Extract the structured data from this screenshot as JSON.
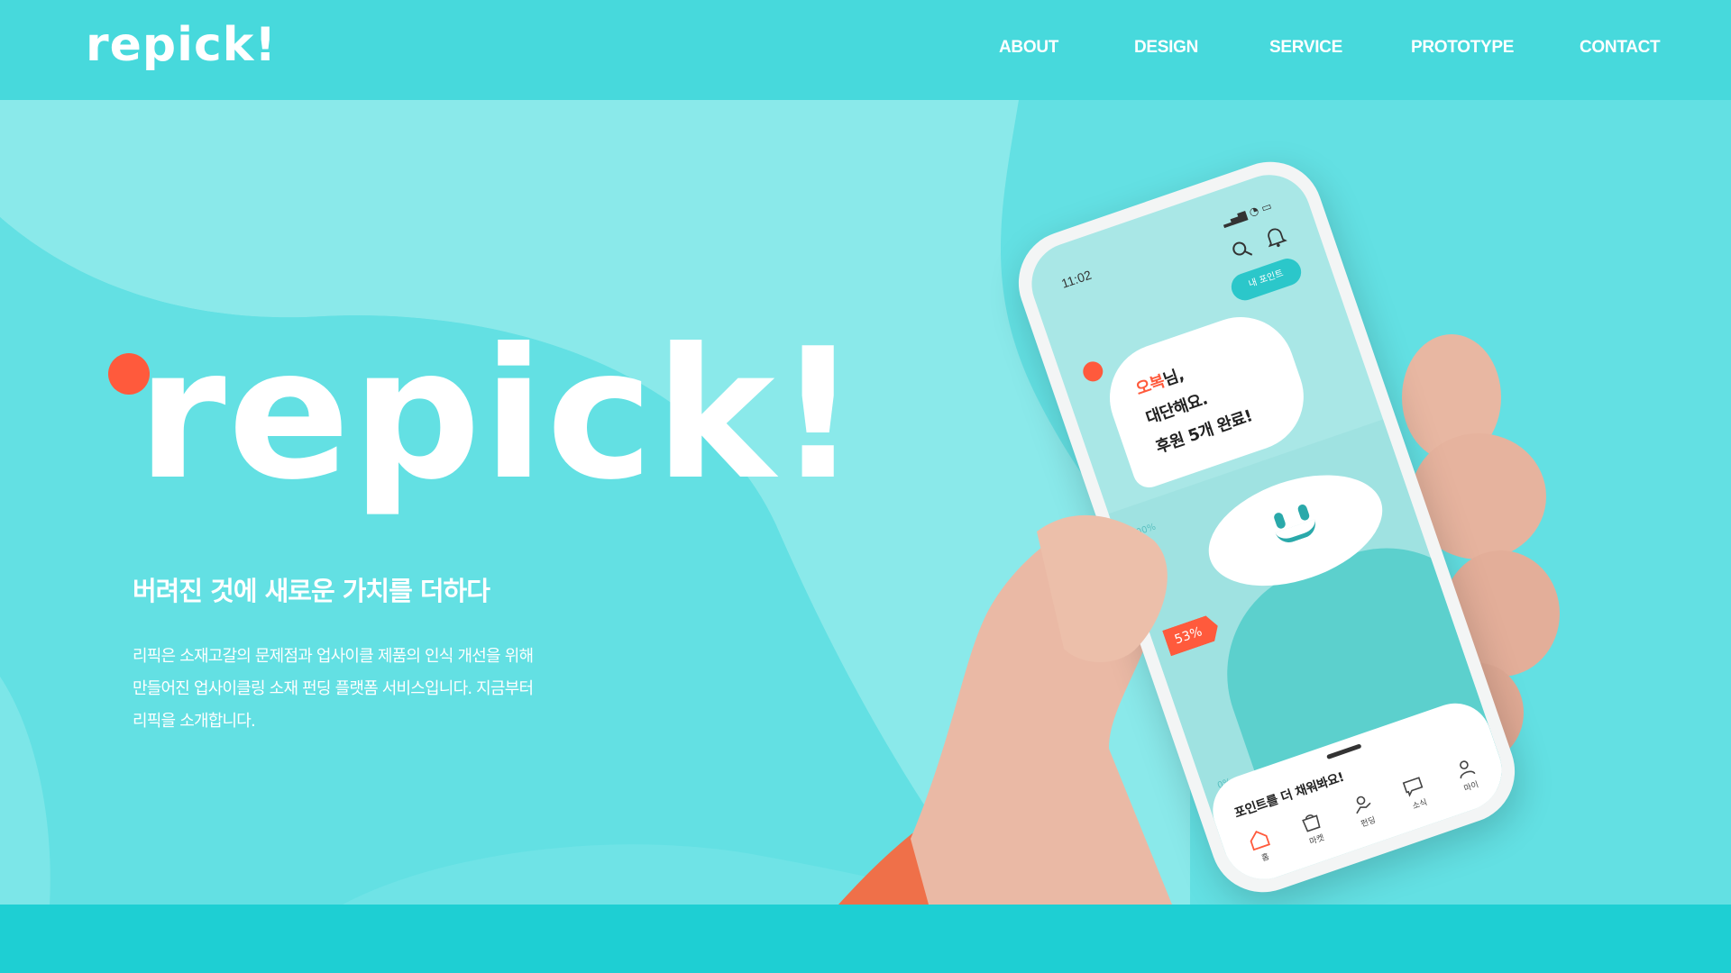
{
  "header": {
    "logo": "repick!",
    "nav": [
      {
        "label": "ABOUT"
      },
      {
        "label": "DESIGN"
      },
      {
        "label": "SERVICE"
      },
      {
        "label": "PROTOTYPE"
      },
      {
        "label": "CONTACT"
      }
    ]
  },
  "hero": {
    "wordmark": "repick!",
    "tagline": "버려진 것에 새로운 가치를 더하다",
    "description": [
      "리픽은 소재고갈의 문제점과 업사이클 제품의 인식 개선을 위해",
      "만들어진 업사이클링 소재 펀딩 플랫폼 서비스입니다. 지금부터",
      "리픽을 소개합니다."
    ]
  },
  "phone": {
    "time": "11:02",
    "points_button": "내 포인트",
    "bubble": {
      "highlight": "오복",
      "line1_rest": "님,",
      "line2": "대단해요.",
      "line3": "후원 5개 완료!"
    },
    "progress_badge": "53%",
    "axis_top": "100%",
    "axis_bottom": "0%",
    "progress_value": 0.53,
    "tab_title": "포인트를 더 채워봐요!",
    "tabs": [
      {
        "label": "홈",
        "icon": "home-icon"
      },
      {
        "label": "마켓",
        "icon": "bag-icon"
      },
      {
        "label": "펀딩",
        "icon": "funding-icon"
      },
      {
        "label": "소식",
        "icon": "chat-icon"
      },
      {
        "label": "마이",
        "icon": "user-icon"
      }
    ]
  },
  "colors": {
    "header_bg": "#47d9dc",
    "hero_bg": "#63e0e3",
    "accent": "#ff5a3c",
    "footer_band": "#1ecfd3"
  }
}
